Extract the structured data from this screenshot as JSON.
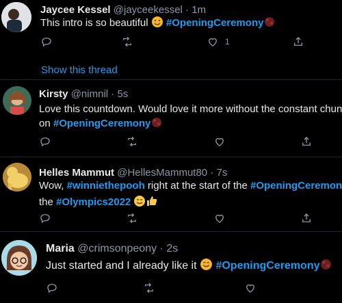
{
  "tweets": [
    {
      "name": "Jaycee Kessel",
      "handle": "@jayceekessel",
      "time": "1m",
      "text1": "This intro is so beautiful ",
      "hashtag1": "#OpeningCeremony",
      "like_count": "1"
    },
    {
      "name": "Kirsty",
      "handle": "@nimnil",
      "time": "5s",
      "text1": "Love this countdown. Would love it more without the constant chunter",
      "text2": "on ",
      "hashtag1": "#OpeningCeremony"
    },
    {
      "name": "Helles Mammut",
      "handle": "@HellesMammut80",
      "time": "7s",
      "text1": "Wow, ",
      "hashtag1": "#winniethepooh",
      "text2": " right at the start of the ",
      "hashtag2": "#OpeningCeremony",
      "text3": "the ",
      "hashtag3": "#Olympics2022"
    },
    {
      "name": "Maria",
      "handle": "@crimsonpeony",
      "time": "2s",
      "text1": "Just started and I already like it ",
      "hashtag1": "#OpeningCeremony"
    }
  ],
  "thread": {
    "label": "Show this thread"
  },
  "separator": "·",
  "icons": [
    "reply-icon",
    "retweet-icon",
    "like-icon",
    "share-icon",
    "flag-emoji-icon",
    "face-emoji-icon",
    "thumbs-up-icon"
  ]
}
